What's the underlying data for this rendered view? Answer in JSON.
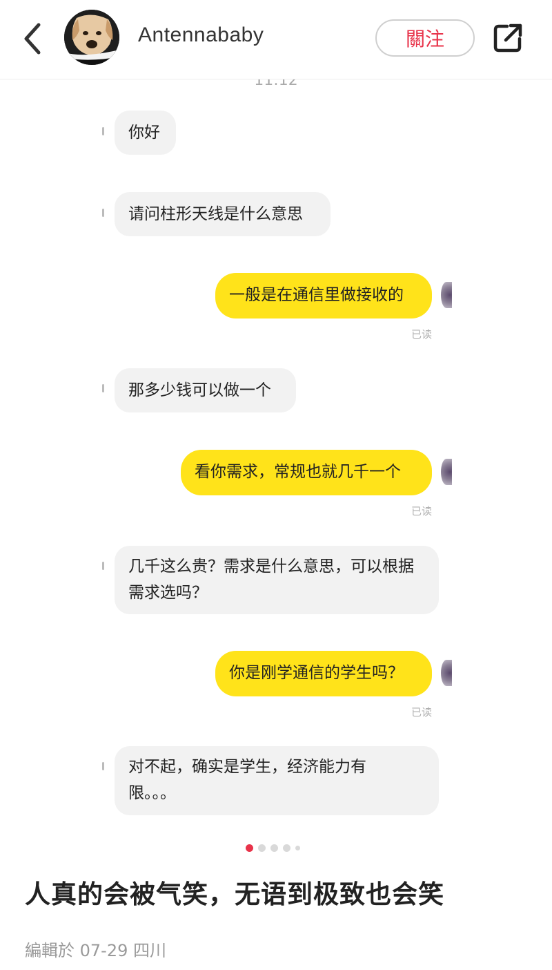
{
  "header": {
    "back_icon": "chevron-left-icon",
    "username": "Antennababy",
    "follow_label": "關注",
    "share_icon": "share-external-icon",
    "accent_color": "#e8334a"
  },
  "chat": {
    "time": "11:12",
    "read_label": "已读",
    "messages": [
      {
        "side": "in",
        "text": "你好"
      },
      {
        "side": "in",
        "text": "请问柱形天线是什么意思"
      },
      {
        "side": "out",
        "text": "一般是在通信里做接收的",
        "status": "已读"
      },
      {
        "side": "in",
        "text": "那多少钱可以做一个"
      },
      {
        "side": "out",
        "text": "看你需求，常规也就几千一个",
        "status": "已读"
      },
      {
        "side": "in",
        "text": "几千这么贵？需求是什么意思，可以根据需求选吗？"
      },
      {
        "side": "out",
        "text": "你是刚学通信的学生吗？",
        "status": "已读"
      },
      {
        "side": "in",
        "text": "对不起，确实是学生，经济能力有限。。。"
      }
    ]
  },
  "pager": {
    "total": 5,
    "active": 1
  },
  "post": {
    "title": "人真的会被气笑，无语到极致也会笑",
    "meta": "編輯於 07-29 四川"
  }
}
